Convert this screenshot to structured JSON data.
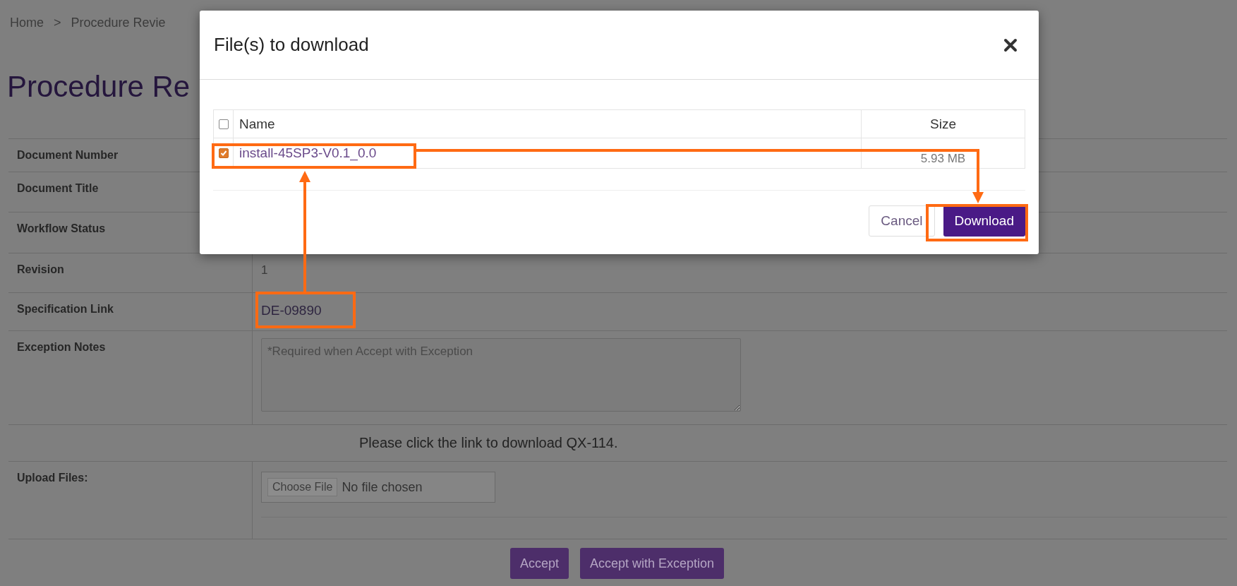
{
  "breadcrumb": {
    "items": [
      {
        "label": "Home"
      },
      {
        "label": "Procedure Revie"
      }
    ],
    "separator": ">"
  },
  "page_title": "Procedure Re",
  "form": {
    "rows": [
      {
        "label": "Document Number",
        "kind": "text"
      },
      {
        "label": "Document Title",
        "kind": "text"
      },
      {
        "label": "Workflow Status",
        "kind": "text"
      },
      {
        "label": "Revision",
        "kind": "text",
        "value": "1"
      },
      {
        "label": "Specification Link",
        "kind": "link",
        "value": "DE-09890"
      },
      {
        "label": "Exception Notes",
        "kind": "textarea",
        "placeholder": "*Required when Accept with Exception"
      },
      {
        "kind": "notice",
        "value": "Please click the link to download QX-114."
      },
      {
        "label": "Upload Files:",
        "kind": "upload",
        "button": "Choose File",
        "status": "No file chosen"
      }
    ]
  },
  "buttons": [
    "Accept",
    "Accept with Exception"
  ],
  "modal": {
    "title": "File(s) to download",
    "table": {
      "columns": [
        "Name",
        "Size"
      ],
      "all_checked": false,
      "rows": [
        {
          "name": "install-45SP3-V0.1_0.0",
          "size": "5.93 MB",
          "checked": true
        }
      ]
    },
    "buttons": [
      {
        "label": "Cancel",
        "kind": "secondary"
      },
      {
        "label": "Download",
        "kind": "primary"
      }
    ]
  }
}
